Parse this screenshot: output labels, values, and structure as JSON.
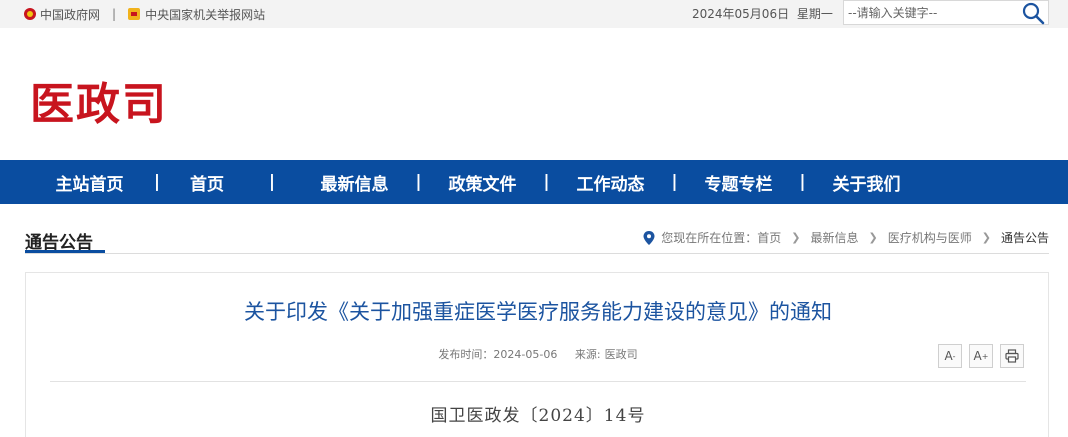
{
  "topbar": {
    "link_gov": "中国政府网",
    "separator": "|",
    "link_report": "中央国家机关举报网站",
    "date": "2024年05月06日",
    "weekday": "星期一",
    "search_placeholder": "--请输入关键字--"
  },
  "header": {
    "logo_text": "医政司"
  },
  "nav": {
    "items": [
      "主站首页",
      "首页",
      "最新信息",
      "政策文件",
      "工作动态",
      "专题专栏",
      "关于我们"
    ],
    "divider": "|"
  },
  "section": {
    "title": "通告公告"
  },
  "breadcrumb": {
    "prefix": "您现在所在位置：",
    "items": [
      "首页",
      "最新信息",
      "医疗机构与医师",
      "通告公告"
    ]
  },
  "article": {
    "title": "关于印发《关于加强重症医学医疗服务能力建设的意见》的通知",
    "publish_label": "发布时间：",
    "publish_date": "2024-05-06",
    "source_label": "来源:",
    "source": "医政司",
    "doc_number": "国卫医政发〔2024〕14号"
  },
  "tools": {
    "font_decrease": "A",
    "font_increase": "A",
    "plus": "+",
    "minus": "-"
  },
  "colors": {
    "brand_red": "#c8141e",
    "nav_blue": "#0a4da0",
    "title_blue": "#1c54a0"
  },
  "icons": [
    "gov-emblem-icon",
    "report-icon",
    "search-icon",
    "location-pin-icon",
    "font-decrease-icon",
    "font-increase-icon",
    "print-icon"
  ]
}
